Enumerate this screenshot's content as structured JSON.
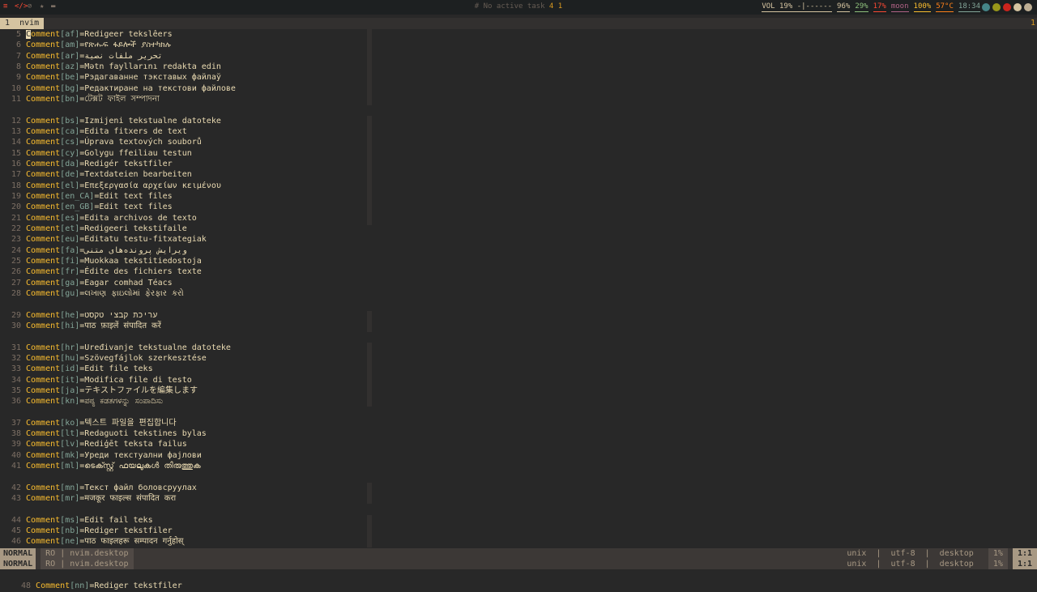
{
  "topbar": {
    "workspaces": [
      "≡",
      "</>",
      "⊘",
      "★",
      "▬"
    ],
    "active_task": "No active task",
    "task_count": "4",
    "task_count2": "1",
    "modules": [
      {
        "label": "VOL 19% -|------",
        "color": "#d5c4a1"
      },
      {
        "label": "96%",
        "color": "#d5c4a1"
      },
      {
        "label": "29%",
        "color": "#8ec07c"
      },
      {
        "label": "17%",
        "color": "#fb4934"
      },
      {
        "label": "moon",
        "color": "#b16286"
      },
      {
        "label": "100%",
        "color": "#fabd2f"
      },
      {
        "label": "57°C",
        "color": "#fe8019"
      },
      {
        "label": "18:34",
        "color": "#83a598"
      }
    ]
  },
  "tabline": {
    "tab_index": "1",
    "tab_label": "nvim",
    "right_num": "1"
  },
  "editor": {
    "lines": [
      {
        "n": "5",
        "lang": "af",
        "val": "Redigeer tekslêers",
        "cursor": true
      },
      {
        "n": "6",
        "lang": "am",
        "val": "የጽሑፍ ፋይሎች ያስተካክሉ"
      },
      {
        "n": "7",
        "lang": "ar",
        "val": "تحرير ملفات نصية"
      },
      {
        "n": "8",
        "lang": "az",
        "val": "Mətn fayllarını redakta edin"
      },
      {
        "n": "9",
        "lang": "be",
        "val": "Рэдагаванне тэкставых файлаў"
      },
      {
        "n": "10",
        "lang": "bg",
        "val": "Редактиране на текстови файлове"
      },
      {
        "n": "11",
        "lang": "bn",
        "val": "টেক্সট ফাইল সম্পাদনা"
      },
      {
        "n": "",
        "lang": "",
        "val": ""
      },
      {
        "n": "12",
        "lang": "bs",
        "val": "Izmijeni tekstualne datoteke"
      },
      {
        "n": "13",
        "lang": "ca",
        "val": "Edita fitxers de text"
      },
      {
        "n": "14",
        "lang": "cs",
        "val": "Úprava textových souborů"
      },
      {
        "n": "15",
        "lang": "cy",
        "val": "Golygu ffeiliau testun"
      },
      {
        "n": "16",
        "lang": "da",
        "val": "Redigér tekstfiler"
      },
      {
        "n": "17",
        "lang": "de",
        "val": "Textdateien bearbeiten"
      },
      {
        "n": "18",
        "lang": "el",
        "val": "Επεξεργασία αρχείων κειμένου"
      },
      {
        "n": "19",
        "lang": "en_CA",
        "val": "Edit text files"
      },
      {
        "n": "20",
        "lang": "en_GB",
        "val": "Edit text files"
      },
      {
        "n": "21",
        "lang": "es",
        "val": "Edita archivos de texto"
      },
      {
        "n": "22",
        "lang": "et",
        "val": "Redigeeri tekstifaile"
      },
      {
        "n": "23",
        "lang": "eu",
        "val": "Editatu testu-fitxategiak"
      },
      {
        "n": "24",
        "lang": "fa",
        "val": "ویرایش پرونده‌های متنی"
      },
      {
        "n": "25",
        "lang": "fi",
        "val": "Muokkaa tekstitiedostoja"
      },
      {
        "n": "26",
        "lang": "fr",
        "val": "Édite des fichiers texte"
      },
      {
        "n": "27",
        "lang": "ga",
        "val": "Eagar comhad Téacs"
      },
      {
        "n": "28",
        "lang": "gu",
        "val": "લખાણ ફાઇલોમાં ફેરફાર કરો"
      },
      {
        "n": "",
        "lang": "",
        "val": ""
      },
      {
        "n": "29",
        "lang": "he",
        "val": "עריכת קבצי טקסט"
      },
      {
        "n": "30",
        "lang": "hi",
        "val": "पाठ फ़ाइलें संपादित करें"
      },
      {
        "n": "",
        "lang": "",
        "val": ""
      },
      {
        "n": "31",
        "lang": "hr",
        "val": "Uređivanje tekstualne datoteke"
      },
      {
        "n": "32",
        "lang": "hu",
        "val": "Szövegfájlok szerkesztése"
      },
      {
        "n": "33",
        "lang": "id",
        "val": "Edit file teks"
      },
      {
        "n": "34",
        "lang": "it",
        "val": "Modifica file di testo"
      },
      {
        "n": "35",
        "lang": "ja",
        "val": "テキストファイルを編集します"
      },
      {
        "n": "36",
        "lang": "kn",
        "val": "ಪಠ್ಯ ಕಡತಗಳನ್ನು ಸಂಪಾದಿಸು"
      },
      {
        "n": "",
        "lang": "",
        "val": ""
      },
      {
        "n": "37",
        "lang": "ko",
        "val": "텍스트 파일을 편집합니다"
      },
      {
        "n": "38",
        "lang": "lt",
        "val": "Redaguoti tekstines bylas"
      },
      {
        "n": "39",
        "lang": "lv",
        "val": "Rediģēt teksta failus"
      },
      {
        "n": "40",
        "lang": "mk",
        "val": "Уреди текстуални фајлови"
      },
      {
        "n": "41",
        "lang": "ml",
        "val": "ടെക്സ്റ്റ് ഫയലുകൾ തിരുത്തുക"
      },
      {
        "n": "",
        "lang": "",
        "val": ""
      },
      {
        "n": "42",
        "lang": "mn",
        "val": "Текст файл боловсруулах"
      },
      {
        "n": "43",
        "lang": "mr",
        "val": "मजकूर फाइल्स संपादित करा"
      },
      {
        "n": "",
        "lang": "",
        "val": ""
      },
      {
        "n": "44",
        "lang": "ms",
        "val": "Edit fail teks"
      },
      {
        "n": "45",
        "lang": "nb",
        "val": "Rediger tekstfiler"
      },
      {
        "n": "46",
        "lang": "ne",
        "val": "पाठ फाइलहरू सम्पादन गर्नुहोस्"
      }
    ],
    "last_line": {
      "n": "48",
      "lang": "nn",
      "val": "Rediger tekstfiler"
    }
  },
  "status": {
    "mode": "NORMAL",
    "flag": "RO",
    "file": "nvim.desktop",
    "format": "unix",
    "encoding": "utf-8",
    "filetype": "desktop",
    "percent": "1%",
    "position": "1:1"
  },
  "comment_key": "Comment"
}
